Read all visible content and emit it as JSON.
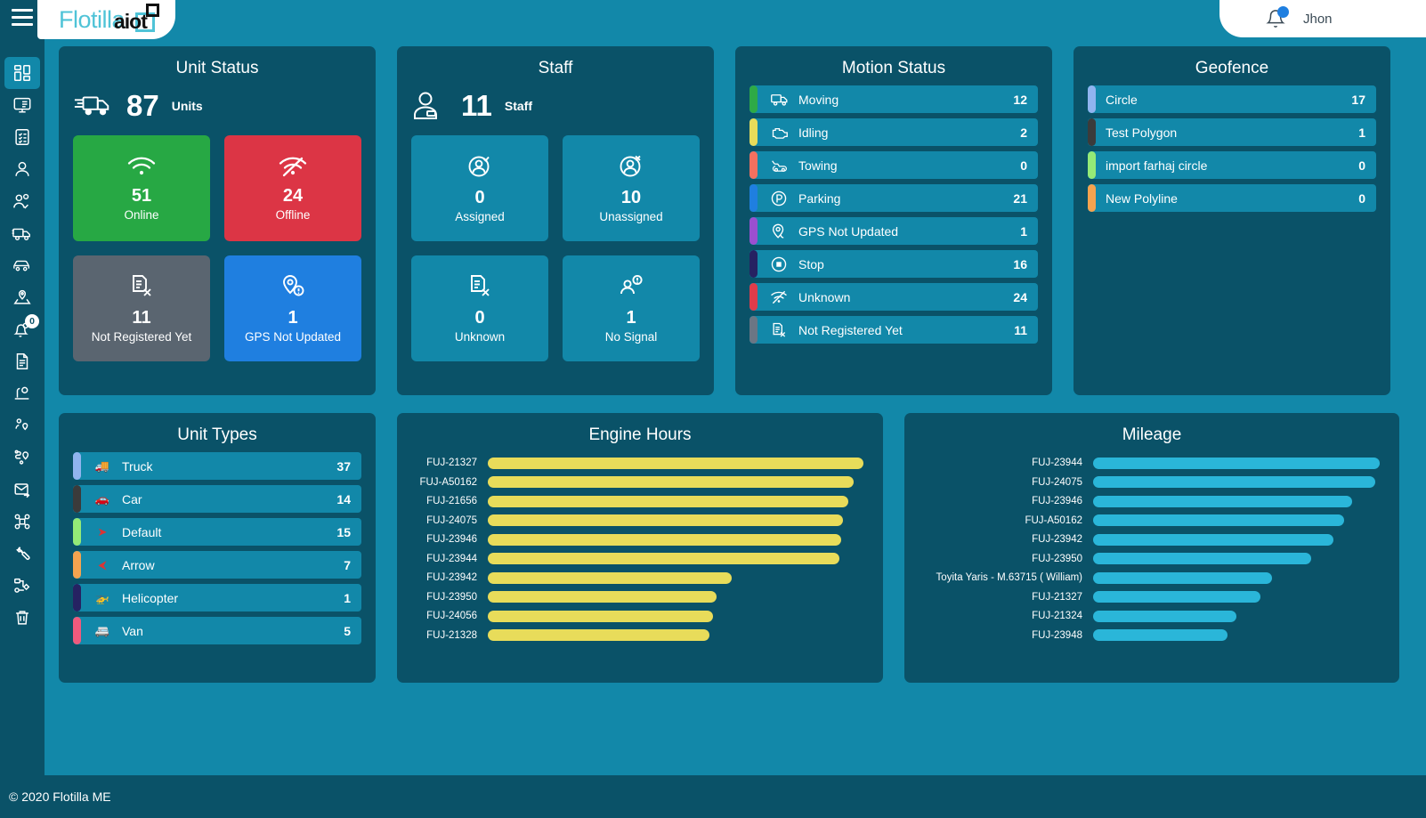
{
  "header": {
    "logo_text": "Flotilla",
    "logo_accent": "aiot",
    "user_name": "Jhon",
    "menu_icon": "hamburger-icon",
    "bell_icon": "bell-icon"
  },
  "sidebar": {
    "items": [
      {
        "name": "dashboard",
        "icon": "dashboard-grid-icon",
        "active": true
      },
      {
        "name": "monitoring",
        "icon": "monitor-list-icon",
        "active": false
      },
      {
        "name": "tasks",
        "icon": "clipboard-check-icon",
        "active": false
      },
      {
        "name": "users",
        "icon": "user-icon",
        "active": false
      },
      {
        "name": "staff",
        "icon": "users-check-icon",
        "active": false
      },
      {
        "name": "trucks",
        "icon": "truck-icon",
        "active": false
      },
      {
        "name": "cars",
        "icon": "car-icon",
        "active": false
      },
      {
        "name": "geofence",
        "icon": "map-pin-area-icon",
        "active": false
      },
      {
        "name": "notifications",
        "icon": "bell-user-icon",
        "active": false,
        "badge": "0"
      },
      {
        "name": "reports",
        "icon": "document-list-icon",
        "active": false
      },
      {
        "name": "places",
        "icon": "place-marker-icon",
        "active": false
      },
      {
        "name": "poi",
        "icon": "pin-person-icon",
        "active": false
      },
      {
        "name": "routes",
        "icon": "route-pin-icon",
        "active": false
      },
      {
        "name": "messages",
        "icon": "envelope-send-icon",
        "active": false
      },
      {
        "name": "integrations",
        "icon": "nodes-icon",
        "active": false
      },
      {
        "name": "maintenance",
        "icon": "wrench-icon",
        "active": false
      },
      {
        "name": "workflow",
        "icon": "flow-diagram-icon",
        "active": false
      },
      {
        "name": "trash",
        "icon": "trash-icon",
        "active": false
      }
    ]
  },
  "unit_status": {
    "title": "Unit Status",
    "total_value": "87",
    "total_label": "Units",
    "total_icon": "truck-icon",
    "tiles": [
      {
        "value": "51",
        "label": "Online",
        "color": "#27a844",
        "icon": "wifi-icon",
        "style": "t-green"
      },
      {
        "value": "24",
        "label": "Offline",
        "color": "#dc3545",
        "icon": "wifi-off-icon",
        "style": "t-red"
      },
      {
        "value": "11",
        "label": "Not Registered Yet",
        "color": "#5a6570",
        "icon": "document-x-icon",
        "style": "t-gray"
      },
      {
        "value": "1",
        "label": "GPS Not Updated",
        "color": "#1f7fe0",
        "icon": "gps-alert-icon",
        "style": "t-blue"
      }
    ]
  },
  "staff": {
    "title": "Staff",
    "total_value": "11",
    "total_label": "Staff",
    "total_icon": "person-badge-icon",
    "tiles": [
      {
        "value": "0",
        "label": "Assigned",
        "color": "#1288a9",
        "icon": "user-check-circle-icon",
        "style": "t-teal"
      },
      {
        "value": "10",
        "label": "Unassigned",
        "color": "#1288a9",
        "icon": "user-x-circle-icon",
        "style": "t-teal"
      },
      {
        "value": "0",
        "label": "Unknown",
        "color": "#1288a9",
        "icon": "document-x-icon",
        "style": "t-teal"
      },
      {
        "value": "1",
        "label": "No Signal",
        "color": "#1288a9",
        "icon": "user-alert-icon",
        "style": "t-teal"
      }
    ]
  },
  "motion_status": {
    "title": "Motion Status",
    "items": [
      {
        "label": "Moving",
        "value": "12",
        "color": "#2eaa46",
        "icon": "truck-icon"
      },
      {
        "label": "Idling",
        "value": "2",
        "color": "#e8dc5a",
        "icon": "engine-icon"
      },
      {
        "label": "Towing",
        "value": "0",
        "color": "#f4705f",
        "icon": "tow-truck-icon"
      },
      {
        "label": "Parking",
        "value": "21",
        "color": "#1f7fe0",
        "icon": "parking-icon"
      },
      {
        "label": "GPS Not Updated",
        "value": "1",
        "color": "#9b4fd0",
        "icon": "gps-alert-icon"
      },
      {
        "label": "Stop",
        "value": "16",
        "color": "#262262",
        "icon": "stop-circle-icon"
      },
      {
        "label": "Unknown",
        "value": "24",
        "color": "#e03c4a",
        "icon": "wifi-off-icon"
      },
      {
        "label": "Not Registered Yet",
        "value": "11",
        "color": "#6b7684",
        "icon": "document-x-icon"
      }
    ]
  },
  "geofence": {
    "title": "Geofence",
    "items": [
      {
        "label": "Circle",
        "value": "17",
        "color": "#90b4ef"
      },
      {
        "label": "Test Polygon",
        "value": "1",
        "color": "#3b3b3b"
      },
      {
        "label": "import farhaj circle",
        "value": "0",
        "color": "#94ea77"
      },
      {
        "label": "New Polyline",
        "value": "0",
        "color": "#f5a34f"
      }
    ]
  },
  "unit_types": {
    "title": "Unit Types",
    "items": [
      {
        "label": "Truck",
        "value": "37",
        "color": "#90b4ef",
        "icon": "truck-icon",
        "glyph": "🚚"
      },
      {
        "label": "Car",
        "value": "14",
        "color": "#3b3b3b",
        "icon": "car-icon",
        "glyph": "🚗"
      },
      {
        "label": "Default",
        "value": "15",
        "color": "#94ea77",
        "icon": "arrow-marker-icon",
        "glyph": "➤"
      },
      {
        "label": "Arrow",
        "value": "7",
        "color": "#f5a34f",
        "icon": "arrow-icon",
        "glyph": "⮜"
      },
      {
        "label": "Helicopter",
        "value": "1",
        "color": "#262262",
        "icon": "helicopter-icon",
        "glyph": "🚁"
      },
      {
        "label": "Van",
        "value": "5",
        "color": "#ef5a7d",
        "icon": "van-icon",
        "glyph": "🚐"
      }
    ]
  },
  "chart_data": [
    {
      "type": "bar",
      "orientation": "horizontal",
      "title": "Engine Hours",
      "xlabel": "",
      "ylabel": "",
      "color": "#e8dc5a",
      "categories": [
        "FUJ-21327",
        "FUJ-A50162",
        "FUJ-21656",
        "FUJ-24075",
        "FUJ-23946",
        "FUJ-23944",
        "FUJ-23942",
        "FUJ-23950",
        "FUJ-24056",
        "FUJ-21328"
      ],
      "values": [
        100,
        97.5,
        96,
        94.5,
        94,
        93.5,
        65,
        61,
        60,
        59
      ],
      "xlim": [
        0,
        100
      ],
      "grid": false,
      "legend": false
    },
    {
      "type": "bar",
      "orientation": "horizontal",
      "title": "Mileage",
      "xlabel": "",
      "ylabel": "",
      "color": "#2ab6d9",
      "categories": [
        "FUJ-23944",
        "FUJ-24075",
        "FUJ-23946",
        "FUJ-A50162",
        "FUJ-23942",
        "FUJ-23950",
        "Toyita Yaris - M.63715 ( William)",
        "FUJ-21327",
        "FUJ-21324",
        "FUJ-23948"
      ],
      "values": [
        100,
        98.5,
        90.5,
        87.5,
        84,
        76,
        62.5,
        58.5,
        50,
        47
      ],
      "xlim": [
        0,
        100
      ],
      "grid": false,
      "legend": false
    }
  ],
  "footer": {
    "copyright": "© 2020 Flotilla ME"
  }
}
